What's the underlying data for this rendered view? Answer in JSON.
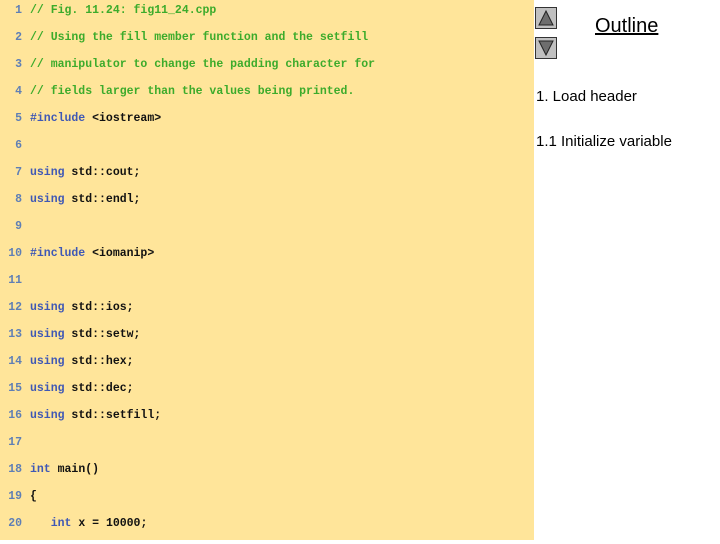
{
  "code": {
    "lines": [
      {
        "n": "1",
        "tokens": [
          {
            "t": "// Fig. 11.24: fig11_24.cpp",
            "k": "comment"
          }
        ]
      },
      {
        "n": "2",
        "tokens": [
          {
            "t": "// Using the fill member function and the setfill",
            "k": "comment"
          }
        ]
      },
      {
        "n": "3",
        "tokens": [
          {
            "t": "// manipulator to change the padding character for",
            "k": "comment"
          }
        ]
      },
      {
        "n": "4",
        "tokens": [
          {
            "t": "// fields larger than the values being printed.",
            "k": "comment"
          }
        ]
      },
      {
        "n": "5",
        "tokens": [
          {
            "t": "#include",
            "k": "keyword"
          },
          {
            "t": " <iostream>",
            "k": "plain"
          }
        ]
      },
      {
        "n": "6",
        "tokens": []
      },
      {
        "n": "7",
        "tokens": [
          {
            "t": "using",
            "k": "keyword"
          },
          {
            "t": " std::cout;",
            "k": "plain"
          }
        ]
      },
      {
        "n": "8",
        "tokens": [
          {
            "t": "using",
            "k": "keyword"
          },
          {
            "t": " std::endl;",
            "k": "plain"
          }
        ]
      },
      {
        "n": "9",
        "tokens": []
      },
      {
        "n": "10",
        "tokens": [
          {
            "t": "#include",
            "k": "keyword"
          },
          {
            "t": " <iomanip>",
            "k": "plain"
          }
        ]
      },
      {
        "n": "11",
        "tokens": []
      },
      {
        "n": "12",
        "tokens": [
          {
            "t": "using",
            "k": "keyword"
          },
          {
            "t": " std::ios;",
            "k": "plain"
          }
        ]
      },
      {
        "n": "13",
        "tokens": [
          {
            "t": "using",
            "k": "keyword"
          },
          {
            "t": " std::setw;",
            "k": "plain"
          }
        ]
      },
      {
        "n": "14",
        "tokens": [
          {
            "t": "using",
            "k": "keyword"
          },
          {
            "t": " std::hex;",
            "k": "plain"
          }
        ]
      },
      {
        "n": "15",
        "tokens": [
          {
            "t": "using",
            "k": "keyword"
          },
          {
            "t": " std::dec;",
            "k": "plain"
          }
        ]
      },
      {
        "n": "16",
        "tokens": [
          {
            "t": "using",
            "k": "keyword"
          },
          {
            "t": " std::setfill;",
            "k": "plain"
          }
        ]
      },
      {
        "n": "17",
        "tokens": []
      },
      {
        "n": "18",
        "tokens": [
          {
            "t": "int",
            "k": "keyword"
          },
          {
            "t": " main()",
            "k": "plain"
          }
        ]
      },
      {
        "n": "19",
        "tokens": [
          {
            "t": "{",
            "k": "plain"
          }
        ]
      },
      {
        "n": "20",
        "tokens": [
          {
            "t": "   ",
            "k": "plain"
          },
          {
            "t": "int",
            "k": "keyword"
          },
          {
            "t": " x = 10000;",
            "k": "plain"
          }
        ]
      }
    ]
  },
  "nav": {
    "up_icon": "triangle-up-icon",
    "down_icon": "triangle-down-icon"
  },
  "outline": {
    "title": "Outline",
    "items": [
      "1. Load header",
      "1.1 Initialize variable"
    ]
  },
  "colors": {
    "panel_bg": "#ffe59a",
    "comment": "#3cab2b",
    "keyword": "#3f58b5",
    "line_number": "#5f7fb5"
  }
}
